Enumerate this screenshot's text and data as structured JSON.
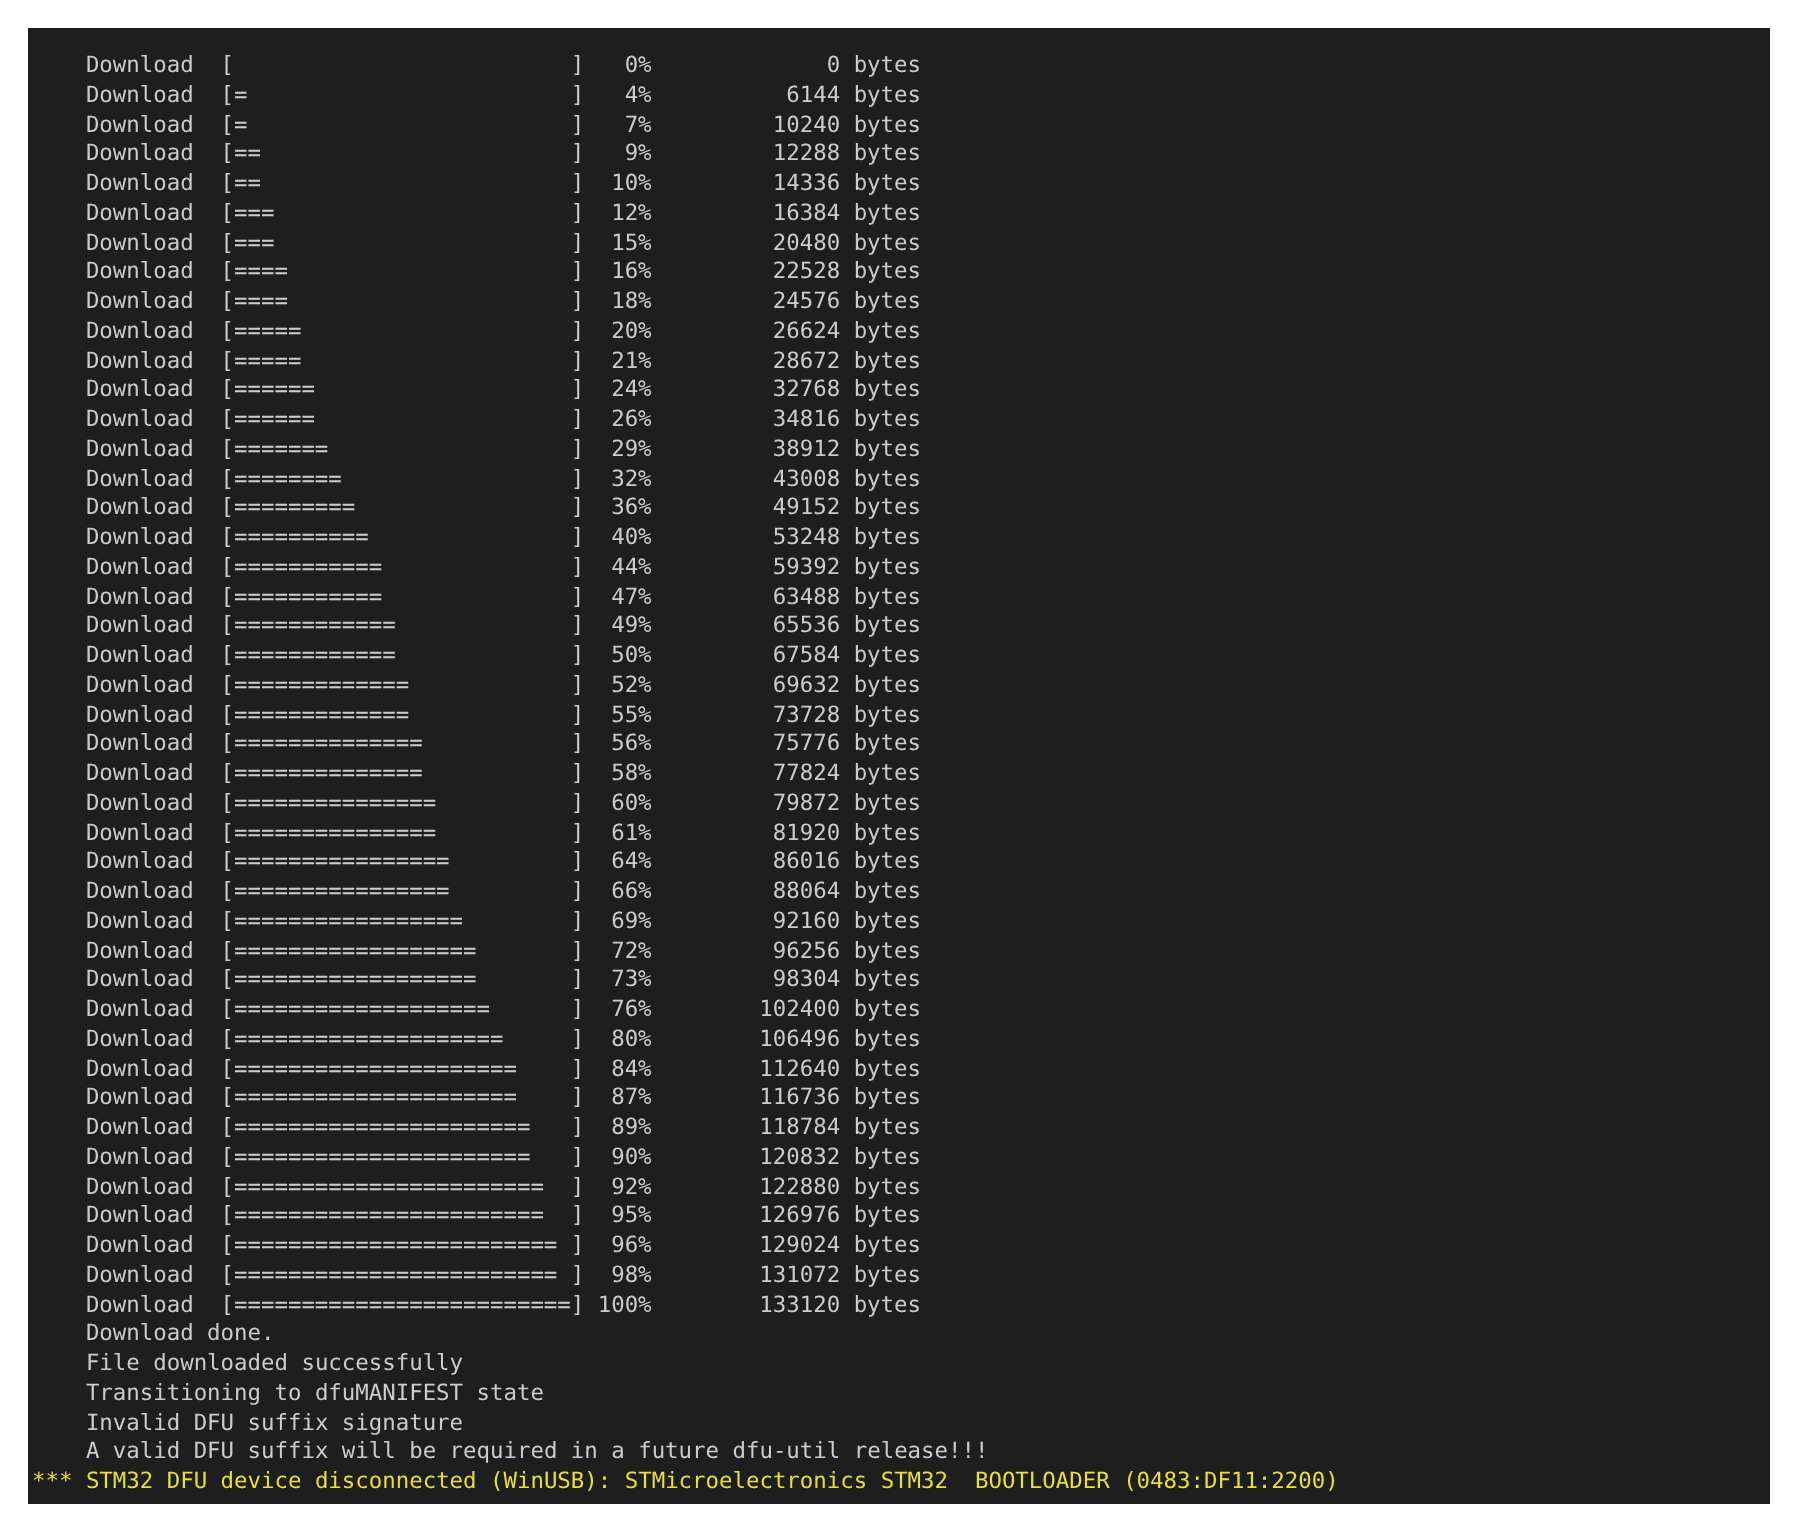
{
  "terminal": {
    "lines": [
      {
        "kind": "progress",
        "label": "Download",
        "bar": "[                         ]",
        "percent": "0%",
        "bytes": "0 bytes"
      },
      {
        "kind": "progress",
        "label": "Download",
        "bar": "[=                        ]",
        "percent": "4%",
        "bytes": "6144 bytes"
      },
      {
        "kind": "progress",
        "label": "Download",
        "bar": "[=                        ]",
        "percent": "7%",
        "bytes": "10240 bytes"
      },
      {
        "kind": "progress",
        "label": "Download",
        "bar": "[==                       ]",
        "percent": "9%",
        "bytes": "12288 bytes"
      },
      {
        "kind": "progress",
        "label": "Download",
        "bar": "[==                       ]",
        "percent": "10%",
        "bytes": "14336 bytes"
      },
      {
        "kind": "progress",
        "label": "Download",
        "bar": "[===                      ]",
        "percent": "12%",
        "bytes": "16384 bytes"
      },
      {
        "kind": "progress",
        "label": "Download",
        "bar": "[===                      ]",
        "percent": "15%",
        "bytes": "20480 bytes"
      },
      {
        "kind": "progress",
        "label": "Download",
        "bar": "[====                     ]",
        "percent": "16%",
        "bytes": "22528 bytes"
      },
      {
        "kind": "progress",
        "label": "Download",
        "bar": "[====                     ]",
        "percent": "18%",
        "bytes": "24576 bytes"
      },
      {
        "kind": "progress",
        "label": "Download",
        "bar": "[=====                    ]",
        "percent": "20%",
        "bytes": "26624 bytes"
      },
      {
        "kind": "progress",
        "label": "Download",
        "bar": "[=====                    ]",
        "percent": "21%",
        "bytes": "28672 bytes"
      },
      {
        "kind": "progress",
        "label": "Download",
        "bar": "[======                   ]",
        "percent": "24%",
        "bytes": "32768 bytes"
      },
      {
        "kind": "progress",
        "label": "Download",
        "bar": "[======                   ]",
        "percent": "26%",
        "bytes": "34816 bytes"
      },
      {
        "kind": "progress",
        "label": "Download",
        "bar": "[=======                  ]",
        "percent": "29%",
        "bytes": "38912 bytes"
      },
      {
        "kind": "progress",
        "label": "Download",
        "bar": "[========                 ]",
        "percent": "32%",
        "bytes": "43008 bytes"
      },
      {
        "kind": "progress",
        "label": "Download",
        "bar": "[=========                ]",
        "percent": "36%",
        "bytes": "49152 bytes"
      },
      {
        "kind": "progress",
        "label": "Download",
        "bar": "[==========               ]",
        "percent": "40%",
        "bytes": "53248 bytes"
      },
      {
        "kind": "progress",
        "label": "Download",
        "bar": "[===========              ]",
        "percent": "44%",
        "bytes": "59392 bytes"
      },
      {
        "kind": "progress",
        "label": "Download",
        "bar": "[===========              ]",
        "percent": "47%",
        "bytes": "63488 bytes"
      },
      {
        "kind": "progress",
        "label": "Download",
        "bar": "[============             ]",
        "percent": "49%",
        "bytes": "65536 bytes"
      },
      {
        "kind": "progress",
        "label": "Download",
        "bar": "[============             ]",
        "percent": "50%",
        "bytes": "67584 bytes"
      },
      {
        "kind": "progress",
        "label": "Download",
        "bar": "[=============            ]",
        "percent": "52%",
        "bytes": "69632 bytes"
      },
      {
        "kind": "progress",
        "label": "Download",
        "bar": "[=============            ]",
        "percent": "55%",
        "bytes": "73728 bytes"
      },
      {
        "kind": "progress",
        "label": "Download",
        "bar": "[==============           ]",
        "percent": "56%",
        "bytes": "75776 bytes"
      },
      {
        "kind": "progress",
        "label": "Download",
        "bar": "[==============           ]",
        "percent": "58%",
        "bytes": "77824 bytes"
      },
      {
        "kind": "progress",
        "label": "Download",
        "bar": "[===============          ]",
        "percent": "60%",
        "bytes": "79872 bytes"
      },
      {
        "kind": "progress",
        "label": "Download",
        "bar": "[===============          ]",
        "percent": "61%",
        "bytes": "81920 bytes"
      },
      {
        "kind": "progress",
        "label": "Download",
        "bar": "[================         ]",
        "percent": "64%",
        "bytes": "86016 bytes"
      },
      {
        "kind": "progress",
        "label": "Download",
        "bar": "[================         ]",
        "percent": "66%",
        "bytes": "88064 bytes"
      },
      {
        "kind": "progress",
        "label": "Download",
        "bar": "[=================        ]",
        "percent": "69%",
        "bytes": "92160 bytes"
      },
      {
        "kind": "progress",
        "label": "Download",
        "bar": "[==================       ]",
        "percent": "72%",
        "bytes": "96256 bytes"
      },
      {
        "kind": "progress",
        "label": "Download",
        "bar": "[==================       ]",
        "percent": "73%",
        "bytes": "98304 bytes"
      },
      {
        "kind": "progress",
        "label": "Download",
        "bar": "[===================      ]",
        "percent": "76%",
        "bytes": "102400 bytes"
      },
      {
        "kind": "progress",
        "label": "Download",
        "bar": "[====================     ]",
        "percent": "80%",
        "bytes": "106496 bytes"
      },
      {
        "kind": "progress",
        "label": "Download",
        "bar": "[=====================    ]",
        "percent": "84%",
        "bytes": "112640 bytes"
      },
      {
        "kind": "progress",
        "label": "Download",
        "bar": "[=====================    ]",
        "percent": "87%",
        "bytes": "116736 bytes"
      },
      {
        "kind": "progress",
        "label": "Download",
        "bar": "[======================   ]",
        "percent": "89%",
        "bytes": "118784 bytes"
      },
      {
        "kind": "progress",
        "label": "Download",
        "bar": "[======================   ]",
        "percent": "90%",
        "bytes": "120832 bytes"
      },
      {
        "kind": "progress",
        "label": "Download",
        "bar": "[=======================  ]",
        "percent": "92%",
        "bytes": "122880 bytes"
      },
      {
        "kind": "progress",
        "label": "Download",
        "bar": "[=======================  ]",
        "percent": "95%",
        "bytes": "126976 bytes"
      },
      {
        "kind": "progress",
        "label": "Download",
        "bar": "[======================== ]",
        "percent": "96%",
        "bytes": "129024 bytes"
      },
      {
        "kind": "progress",
        "label": "Download",
        "bar": "[======================== ]",
        "percent": "98%",
        "bytes": "131072 bytes"
      },
      {
        "kind": "progress",
        "label": "Download",
        "bar": "[=========================]",
        "percent": "100%",
        "bytes": "133120 bytes"
      },
      {
        "kind": "message",
        "text": "Download done."
      },
      {
        "kind": "message",
        "text": "File downloaded successfully"
      },
      {
        "kind": "message",
        "text": "Transitioning to dfuMANIFEST state"
      },
      {
        "kind": "message",
        "text": "Invalid DFU suffix signature"
      },
      {
        "kind": "message",
        "text": "A valid DFU suffix will be required in a future dfu-util release!!!"
      },
      {
        "kind": "notice",
        "text": "*** STM32 DFU device disconnected (WinUSB): STMicroelectronics STM32  BOOTLOADER (0483:DF11:2200)"
      }
    ]
  }
}
